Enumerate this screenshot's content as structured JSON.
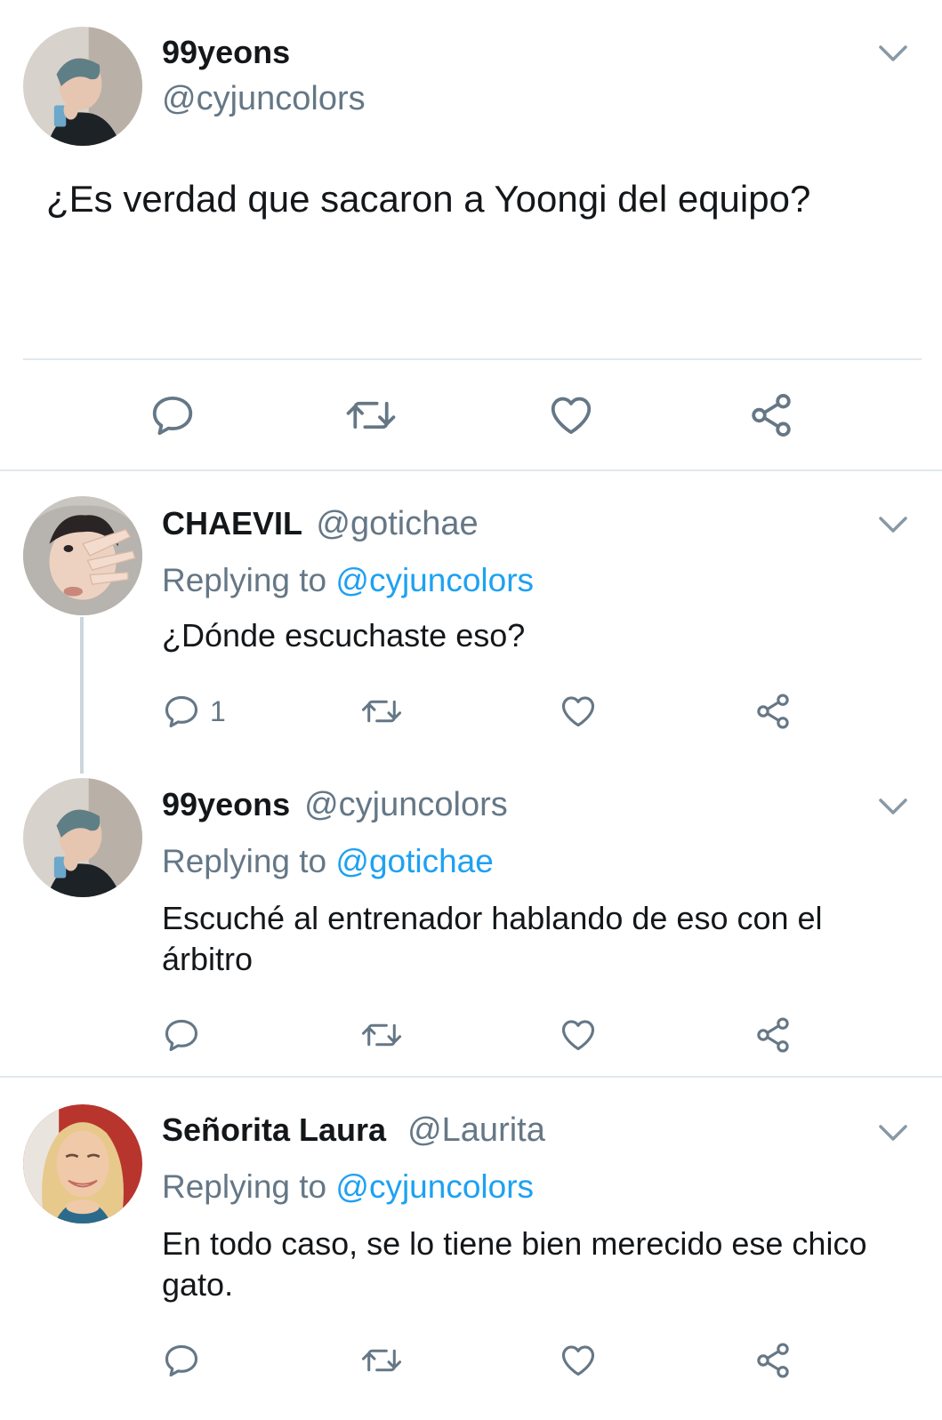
{
  "main_tweet": {
    "display_name": "99yeons",
    "handle": "@cyjuncolors",
    "text": "¿Es verdad que sacaron a Yoongi del equipo?"
  },
  "replies": [
    {
      "display_name": "CHAEVIL",
      "handle": "@gotichae",
      "replying_label": "Replying to",
      "replying_to": "@cyjuncolors",
      "text": "¿Dónde escuchaste eso?",
      "reply_count": "1"
    },
    {
      "display_name": "99yeons",
      "handle": "@cyjuncolors",
      "replying_label": "Replying to",
      "replying_to": "@gotichae",
      "text": "Escuché al entrenador hablando de eso con el árbitro"
    },
    {
      "display_name": "Señorita Laura",
      "handle": "@Laurita",
      "replying_label": "Replying to",
      "replying_to": "@cyjuncolors",
      "text": "En todo caso, se lo tiene bien merecido ese chico gato."
    }
  ],
  "icons": {
    "reply": "reply-icon",
    "retweet": "retweet-icon",
    "like": "heart-icon",
    "share": "share-icon",
    "menu": "chevron-down-icon"
  },
  "colors": {
    "link": "#1da1f2",
    "secondary_text": "#657786",
    "icon_gray": "#657786",
    "divider": "#e1e8ed"
  }
}
